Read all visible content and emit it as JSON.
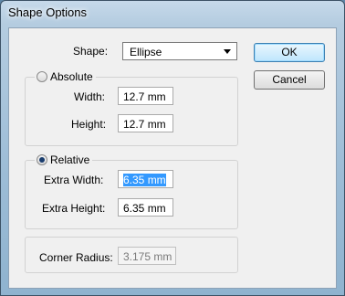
{
  "window": {
    "title": "Shape Options"
  },
  "shape": {
    "label": "Shape:",
    "value": "Ellipse"
  },
  "absolute": {
    "label": "Absolute",
    "selected": false,
    "width_label": "Width:",
    "width_value": "12.7 mm",
    "height_label": "Height:",
    "height_value": "12.7 mm"
  },
  "relative": {
    "label": "Relative",
    "selected": true,
    "extra_width_label": "Extra Width:",
    "extra_width_value": "6.35 mm",
    "extra_height_label": "Extra Height:",
    "extra_height_value": "6.35 mm"
  },
  "corner": {
    "label": "Corner Radius:",
    "value": "3.175 mm",
    "enabled": false
  },
  "buttons": {
    "ok": "OK",
    "cancel": "Cancel"
  },
  "colors": {
    "selection": "#3399ff",
    "default_button": "#bee6fd"
  }
}
